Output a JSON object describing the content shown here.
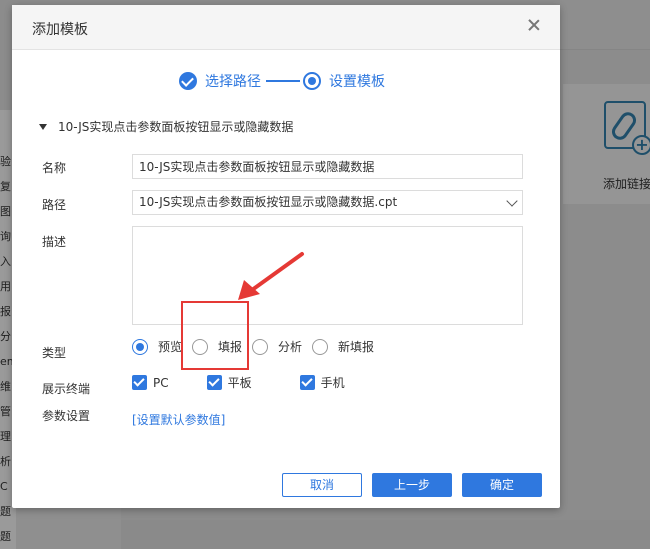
{
  "background": {
    "side_chars": [
      "验",
      "复",
      "图",
      "询",
      "入",
      "用",
      "报",
      "分",
      "em",
      "维",
      "管",
      "理",
      "析",
      "C",
      "题",
      "题"
    ],
    "link_label": "添加链接"
  },
  "dialog": {
    "title": "添加模板",
    "steps": [
      {
        "label": "选择路径",
        "state": "done"
      },
      {
        "label": "设置模板",
        "state": "current"
      }
    ],
    "section_title": "10-JS实现点击参数面板按钮显示或隐藏数据",
    "form": {
      "name_label": "名称",
      "name_value": "10-JS实现点击参数面板按钮显示或隐藏数据",
      "path_label": "路径",
      "path_value": "10-JS实现点击参数面板按钮显示或隐藏数据.cpt",
      "desc_label": "描述",
      "desc_value": "",
      "type_label": "类型",
      "type_options": [
        {
          "label": "预览",
          "selected": true
        },
        {
          "label": "填报",
          "selected": false
        },
        {
          "label": "分析",
          "selected": false
        },
        {
          "label": "新填报",
          "selected": false
        }
      ],
      "terminal_label": "展示终端",
      "terminal_options": [
        {
          "label": "PC",
          "checked": true
        },
        {
          "label": "平板",
          "checked": true
        },
        {
          "label": "手机",
          "checked": true
        }
      ],
      "param_label": "参数设置",
      "param_link": "[设置默认参数值]"
    },
    "buttons": {
      "cancel": "取消",
      "prev": "上一步",
      "ok": "确定"
    }
  },
  "colors": {
    "accent": "#2f78df",
    "annotation": "#e53935"
  }
}
